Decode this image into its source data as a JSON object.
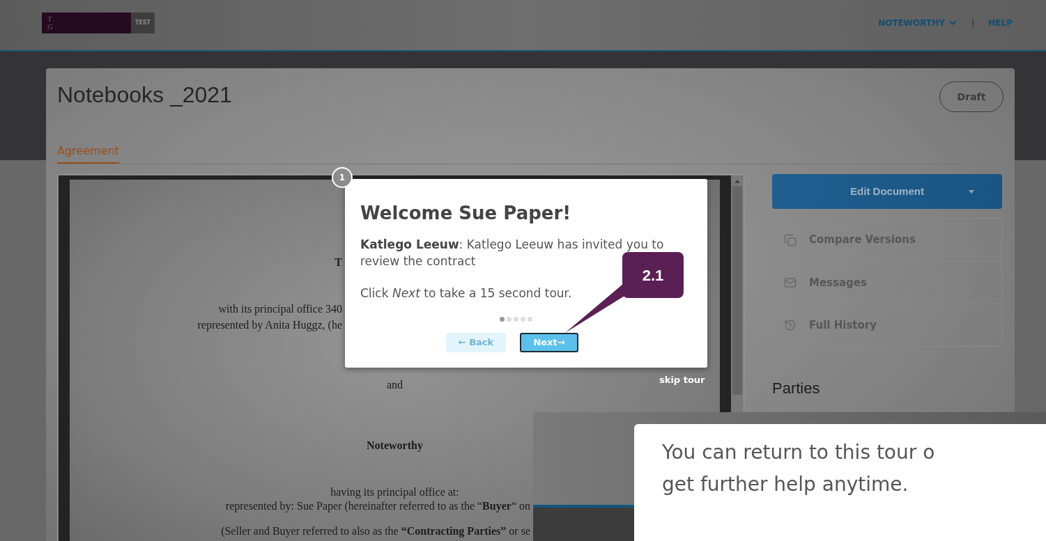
{
  "header": {
    "logo": {
      "monogram": "TG",
      "badge": "TEST"
    },
    "nav": [
      {
        "kind": "menu",
        "label": "NOTEWORTHY"
      },
      {
        "kind": "separator",
        "label": "|"
      },
      {
        "kind": "link",
        "label": "HELP"
      }
    ]
  },
  "document": {
    "title": "Notebooks _2021",
    "status": "Draft",
    "tabs": [
      {
        "label": "Agreement",
        "selected": true
      }
    ],
    "page_lines": [
      {
        "kind": "cut_by_popup",
        "text": "T",
        "bold": true
      },
      {
        "kind": "cut_by_popup",
        "text": "with its principal office 340",
        "bold": false
      },
      {
        "kind": "cut_by_popup",
        "text": "represented by Anita Huggz, (he",
        "bold": false
      },
      {
        "kind": "center",
        "text": "and",
        "bold": false
      },
      {
        "kind": "center",
        "text": "Noteworthy",
        "bold": true
      },
      {
        "kind": "center",
        "text": "having its principal office at:",
        "bold": false
      },
      {
        "kind": "cut_by_inset",
        "text": "represented by: Sue Paper (hereinafter referred to as the “**Buyer**“ on",
        "bold": false
      },
      {
        "kind": "cut_by_inset",
        "text": "(Seller and Buyer referred to also as the **“Contracting Parties”** or se",
        "bold": false
      }
    ]
  },
  "sidebar": {
    "primary_action": "Edit Document",
    "actions": [
      {
        "kind": "compare",
        "label": "Compare Versions"
      },
      {
        "kind": "messages",
        "label": "Messages"
      },
      {
        "kind": "history",
        "label": "Full History"
      }
    ],
    "section_title": "Parties"
  },
  "tour": {
    "step": "1",
    "title": "Welcome Sue Paper!",
    "sender": "Katlego Leeuw",
    "message": ": Katlego Leeuw has invited you to review the contract",
    "instruction": "Click *Next*  to take a 15 second tour.",
    "dots": [
      {
        "selected": true
      },
      {
        "selected": false
      },
      {
        "selected": false
      },
      {
        "selected": false
      },
      {
        "selected": false
      }
    ],
    "buttons": [
      {
        "kind": "back",
        "label": "← Back",
        "disabled": true
      },
      {
        "kind": "next",
        "label": "Next→",
        "disabled": false
      }
    ],
    "skip": "skip tour",
    "callout": "2.1"
  },
  "inset": {
    "lines": [
      "You can return to this tour o",
      "get further help anytime."
    ]
  }
}
